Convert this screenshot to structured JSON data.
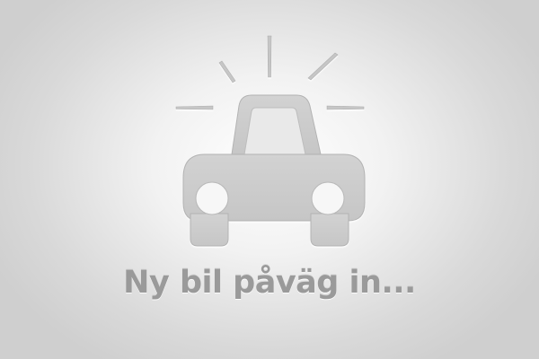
{
  "placeholder": {
    "icon": "car-icon",
    "caption": "Ny bil påväg in..."
  },
  "colors": {
    "icon_fill": "#cccccc",
    "icon_outline": "#b3b3b3",
    "caption_color": "#9a9a9a"
  }
}
